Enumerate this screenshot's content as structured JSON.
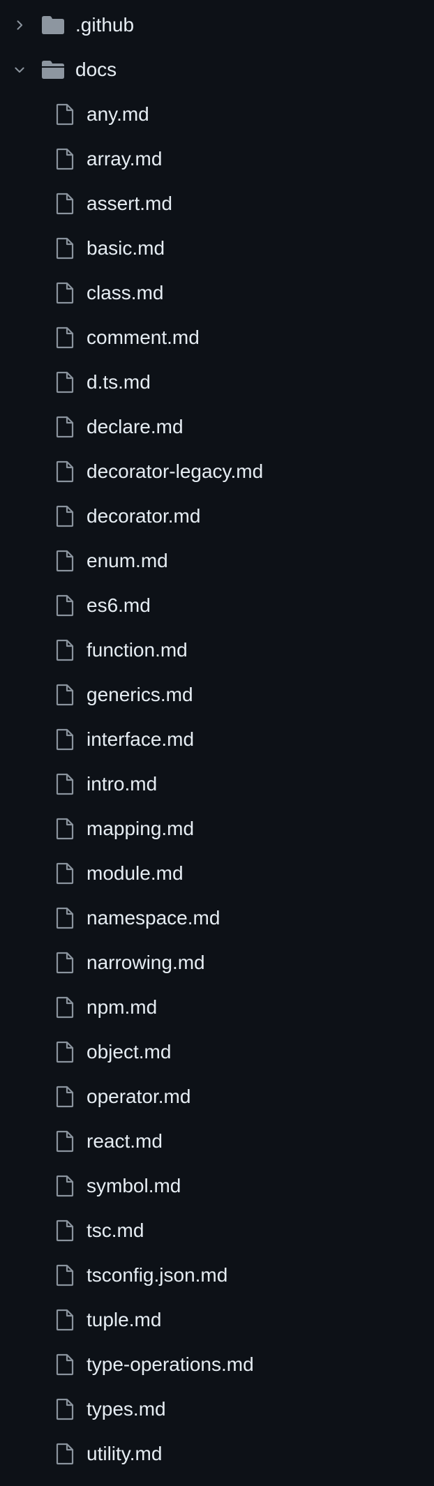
{
  "colors": {
    "background": "#0d1117",
    "text": "#e6edf3",
    "icon": "#8b949e",
    "folder": "#8d96a0"
  },
  "tree": {
    "folders": [
      {
        "label": ".github",
        "expanded": false,
        "icon": "folder-icon",
        "chevron": "chevron-right-icon"
      },
      {
        "label": "docs",
        "expanded": true,
        "icon": "folder-open-icon",
        "chevron": "chevron-down-icon"
      }
    ],
    "files": [
      {
        "label": "any.md",
        "icon": "file-icon"
      },
      {
        "label": "array.md",
        "icon": "file-icon"
      },
      {
        "label": "assert.md",
        "icon": "file-icon"
      },
      {
        "label": "basic.md",
        "icon": "file-icon"
      },
      {
        "label": "class.md",
        "icon": "file-icon"
      },
      {
        "label": "comment.md",
        "icon": "file-icon"
      },
      {
        "label": "d.ts.md",
        "icon": "file-icon"
      },
      {
        "label": "declare.md",
        "icon": "file-icon"
      },
      {
        "label": "decorator-legacy.md",
        "icon": "file-icon"
      },
      {
        "label": "decorator.md",
        "icon": "file-icon"
      },
      {
        "label": "enum.md",
        "icon": "file-icon"
      },
      {
        "label": "es6.md",
        "icon": "file-icon"
      },
      {
        "label": "function.md",
        "icon": "file-icon"
      },
      {
        "label": "generics.md",
        "icon": "file-icon"
      },
      {
        "label": "interface.md",
        "icon": "file-icon"
      },
      {
        "label": "intro.md",
        "icon": "file-icon"
      },
      {
        "label": "mapping.md",
        "icon": "file-icon"
      },
      {
        "label": "module.md",
        "icon": "file-icon"
      },
      {
        "label": "namespace.md",
        "icon": "file-icon"
      },
      {
        "label": "narrowing.md",
        "icon": "file-icon"
      },
      {
        "label": "npm.md",
        "icon": "file-icon"
      },
      {
        "label": "object.md",
        "icon": "file-icon"
      },
      {
        "label": "operator.md",
        "icon": "file-icon"
      },
      {
        "label": "react.md",
        "icon": "file-icon"
      },
      {
        "label": "symbol.md",
        "icon": "file-icon"
      },
      {
        "label": "tsc.md",
        "icon": "file-icon"
      },
      {
        "label": "tsconfig.json.md",
        "icon": "file-icon"
      },
      {
        "label": "tuple.md",
        "icon": "file-icon"
      },
      {
        "label": "type-operations.md",
        "icon": "file-icon"
      },
      {
        "label": "types.md",
        "icon": "file-icon"
      },
      {
        "label": "utility.md",
        "icon": "file-icon"
      }
    ]
  }
}
